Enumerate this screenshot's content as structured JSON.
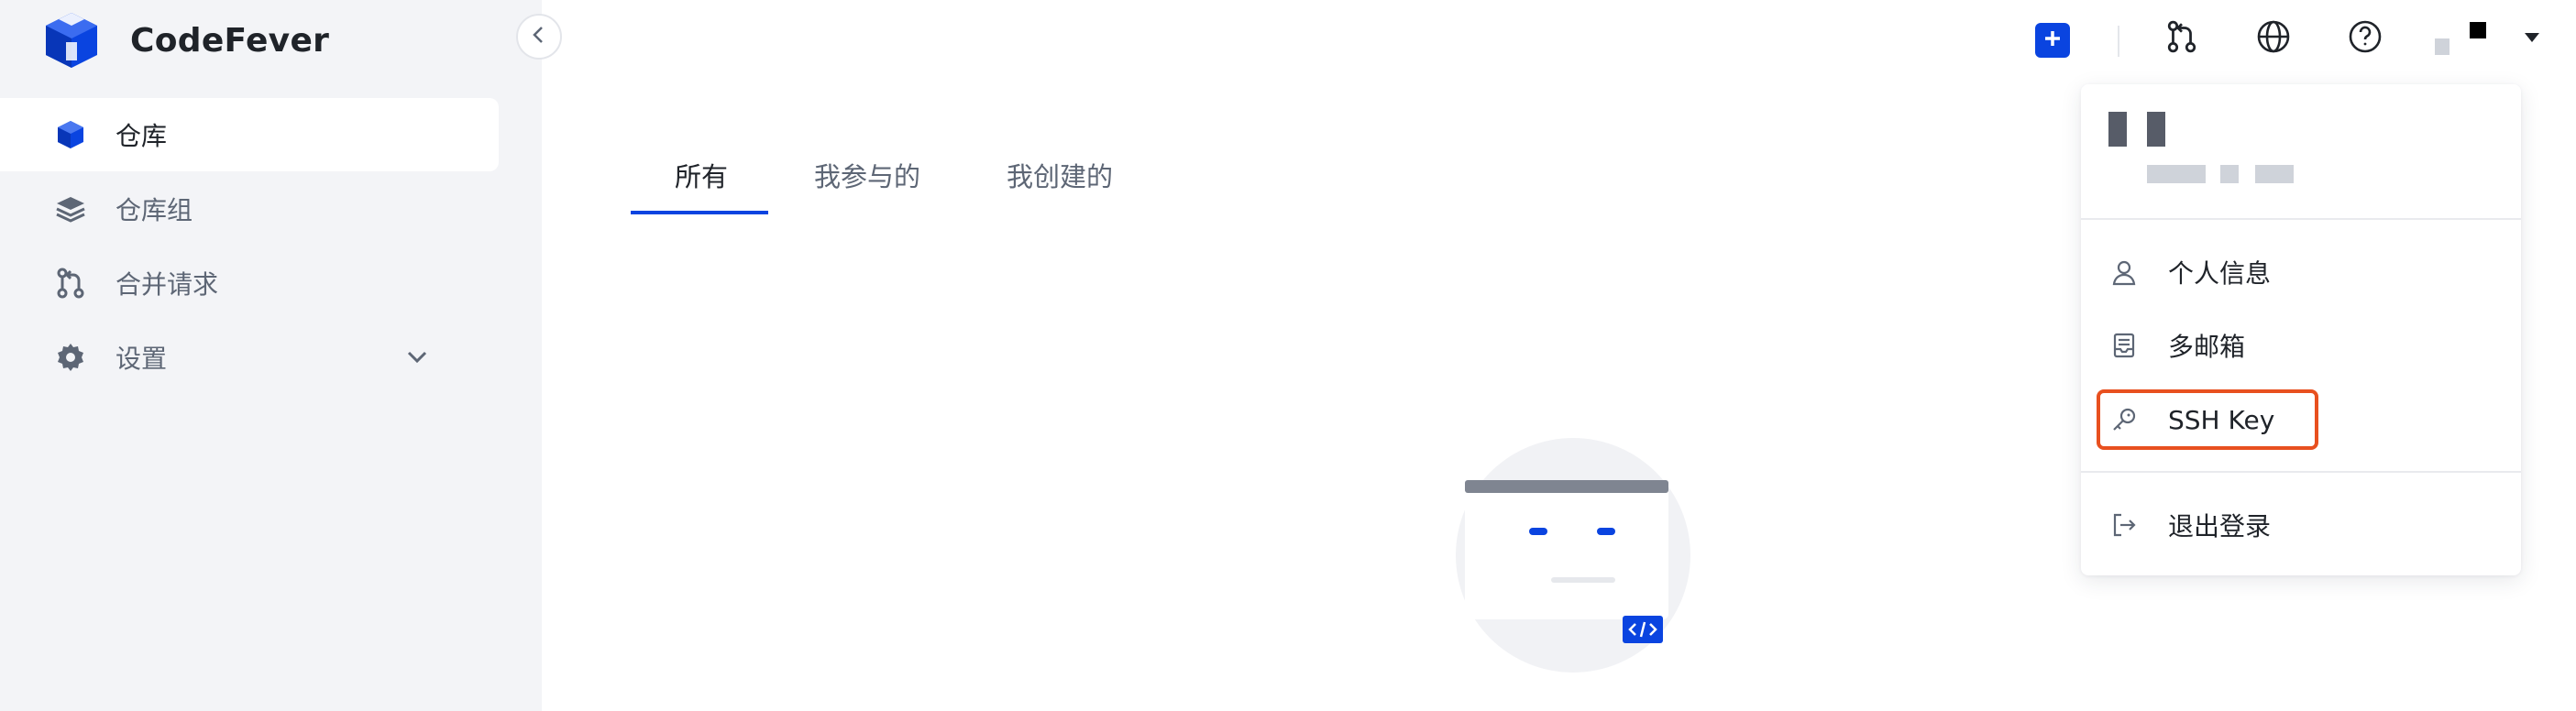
{
  "app": {
    "name": "CodeFever"
  },
  "sidebar": {
    "items": [
      {
        "label": "仓库",
        "icon": "cube-icon",
        "active": true
      },
      {
        "label": "仓库组",
        "icon": "layers-icon",
        "active": false
      },
      {
        "label": "合并请求",
        "icon": "merge-request-icon",
        "active": false
      },
      {
        "label": "设置",
        "icon": "gear-icon",
        "active": false,
        "expandable": true
      }
    ]
  },
  "topbar": {
    "icons": [
      "add-icon",
      "merge-request-icon",
      "globe-icon",
      "help-icon",
      "avatar",
      "caret-down-icon"
    ]
  },
  "tabs": [
    {
      "label": "所有",
      "active": true
    },
    {
      "label": "我参与的",
      "active": false
    },
    {
      "label": "我创建的",
      "active": false
    }
  ],
  "user_menu": {
    "items": [
      {
        "label": "个人信息",
        "icon": "user-icon"
      },
      {
        "label": "多邮箱",
        "icon": "inbox-icon"
      },
      {
        "label": "SSH Key",
        "icon": "key-icon",
        "highlighted": true
      },
      {
        "label": "退出登录",
        "icon": "logout-icon"
      }
    ]
  },
  "colors": {
    "accent": "#0a44e0",
    "sidebar_bg": "#f3f4f7",
    "highlight_border": "#e8501f"
  }
}
